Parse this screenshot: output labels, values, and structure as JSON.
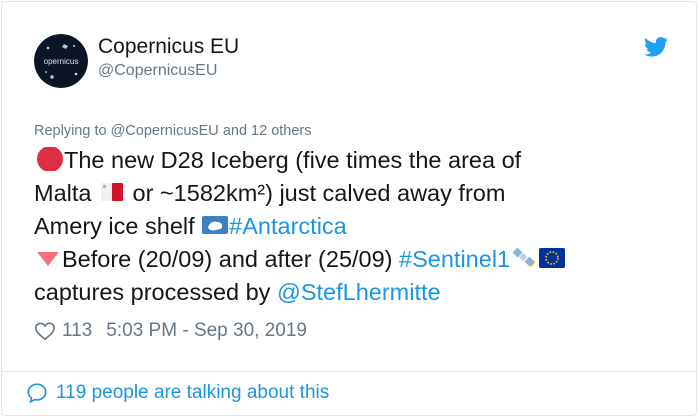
{
  "account": {
    "display_name": "Copernicus EU",
    "handle": "@CopernicusEU",
    "avatar_text": "opernicus"
  },
  "tweet": {
    "replying_prefix": "Replying to",
    "replying_to": "@CopernicusEU",
    "replying_suffix": "and 12 others",
    "line1": "The new D28 Iceberg (five times the area of",
    "line2a": "Malta",
    "line2b": "or ~1582km²) just calved away from",
    "line3a": "Amery ice shelf",
    "line3_hashtag": "#Antarctica",
    "line4a": "Before (20/09) and after (25/09)",
    "line4_hashtag": "#Sentinel1",
    "line5a": "captures processed by",
    "line5_mention": "@StefLhermitte"
  },
  "meta": {
    "likes": "113",
    "timestamp": "5:03 PM - Sep 30, 2019"
  },
  "footer": {
    "talking": "119 people are talking about this"
  },
  "colors": {
    "link": "#1b95e0",
    "text": "#14171a",
    "muted": "#657786",
    "border": "#e1e8ed"
  },
  "icons": [
    "twitter-bird-icon",
    "red-circle-emoji",
    "malta-flag-emoji",
    "antarctica-emoji",
    "red-triangle-emoji",
    "satellite-emoji",
    "eu-flag-emoji",
    "heart-icon",
    "speech-bubble-icon"
  ]
}
